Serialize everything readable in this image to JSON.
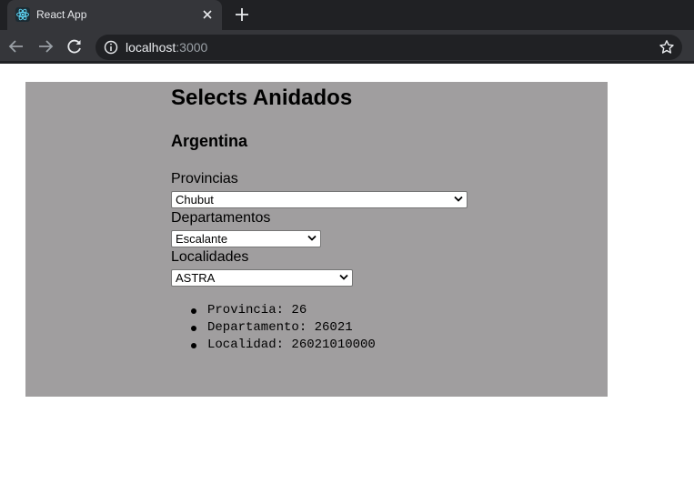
{
  "browser": {
    "tab_title": "React App",
    "url_host": "localhost",
    "url_port": ":3000"
  },
  "page": {
    "title": "Selects Anidados",
    "country": "Argentina",
    "provincias_label": "Provincias",
    "provincias_value": "Chubut",
    "departamentos_label": "Departamentos",
    "departamentos_value": "Escalante",
    "localidades_label": "Localidades",
    "localidades_value": "ASTRA",
    "results": [
      "Provincia: 26",
      "Departamento: 26021",
      "Localidad: 26021010000"
    ]
  },
  "colors": {
    "tab_bg": "#35363a",
    "tabstrip_bg": "#202124",
    "app_bg": "#a09e9f"
  }
}
